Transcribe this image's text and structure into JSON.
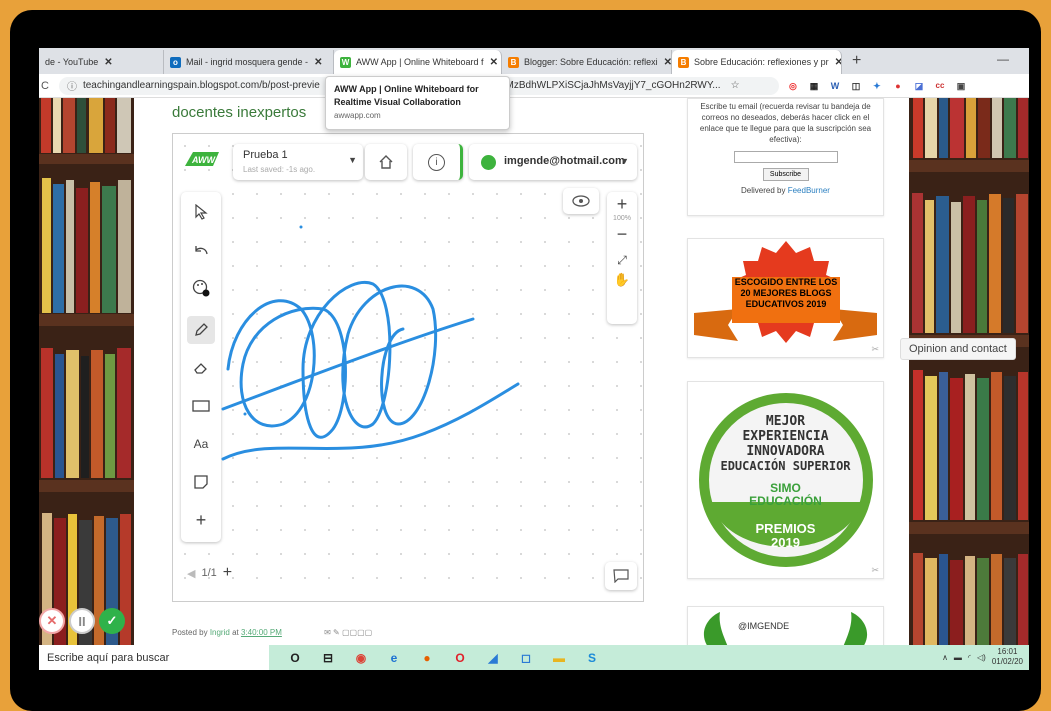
{
  "browser": {
    "tabs": [
      {
        "label": "de - YouTube",
        "icon": "youtube-icon"
      },
      {
        "label": "Mail - ingrid mosquera gende - ",
        "icon": "outlook-icon",
        "color": "#0f6cbd"
      },
      {
        "label": "AWW App | Online Whiteboard f",
        "icon": "aww-icon",
        "color": "#3db33d",
        "active": true
      },
      {
        "label": "Blogger: Sobre Educación: reflexi",
        "icon": "blogger-icon",
        "color": "#f57d00"
      },
      {
        "label": "Sobre Educación: reflexiones y pr",
        "icon": "blogger-icon",
        "color": "#f57d00"
      }
    ],
    "url_left": "teachingandlearningspain.blogspot.com/b/post-previe",
    "url_right": "0Ir9n8KcloWrvmMzBdhWLPXiSCjaJhMsVayjjY7_cGOHn2RWY...",
    "tooltip": {
      "title": "AWW App | Online Whiteboard for Realtime Visual Collaboration",
      "domain": "awwapp.com"
    }
  },
  "post": {
    "heading": "docentes inexpertos",
    "posted_by_prefix": "Posted by",
    "author": "Ingrid",
    "at": "at",
    "time": "3:40:00 PM"
  },
  "whiteboard": {
    "board_name": "Prueba 1",
    "saved": "Last saved: -1s ago.",
    "user": "imgende@hotmail.com",
    "zoom": "100%",
    "page": "1/1",
    "accent": "#3db33d",
    "stroke_color": "#2a8ee0",
    "tools": [
      "cursor-icon",
      "undo-icon",
      "palette-icon",
      "pencil-icon",
      "eraser-icon",
      "rectangle-icon",
      "text-tool",
      "sticky-note-icon",
      "plus-icon"
    ],
    "text_tool_label": "Aa"
  },
  "sidebar": {
    "subscribe_text": "Escribe tu email (recuerda revisar tu bandeja de correos no deseados, deberás hacer click en el enlace que te llegue para que la suscripción sea efectiva):",
    "subscribe_button": "Subscribe",
    "delivered": "Delivered by",
    "feedburner": "FeedBurner",
    "badge1": "ESCOGIDO ENTRE LOS 20 MEJORES BLOGS EDUCATIVOS 2019",
    "badge2_lines": [
      "MEJOR",
      "EXPERIENCIA",
      "INNOVADORA",
      "EDUCACIÓN SUPERIOR"
    ],
    "badge2_brand": "SIMO",
    "badge2_brand_sub": "EDUCACIÓN",
    "badge2_award": "PREMIOS",
    "badge2_year": "2019",
    "badge3_label": "@IMGENDE"
  },
  "opinion_label": "Opinion and contact",
  "taskbar": {
    "search_placeholder": "Escribe aquí para buscar",
    "clock_time": "16:01",
    "clock_date": "01/02/20"
  }
}
